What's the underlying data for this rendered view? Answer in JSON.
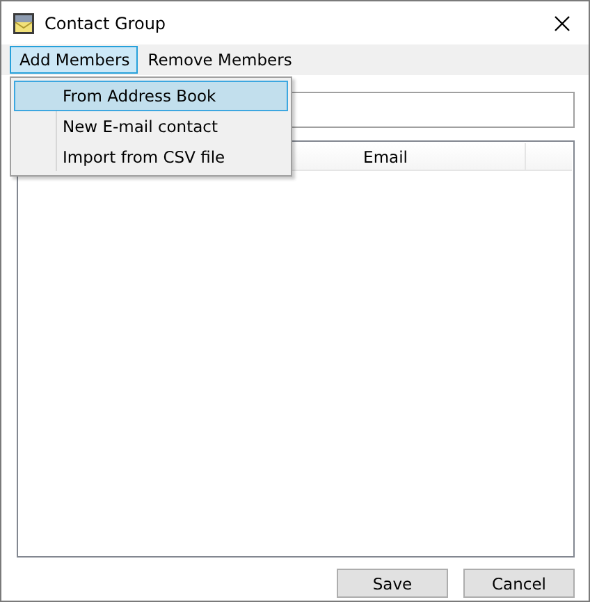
{
  "window": {
    "title": "Contact Group"
  },
  "menu": [
    {
      "label": "Add Members",
      "selected": true
    },
    {
      "label": "Remove Members",
      "selected": false
    }
  ],
  "dropdown": {
    "items": [
      {
        "label": "From Address Book",
        "selected": true
      },
      {
        "label": "New E-mail contact",
        "selected": false
      },
      {
        "label": "Import from CSV file",
        "selected": false
      }
    ]
  },
  "table": {
    "columns": [
      "Email"
    ]
  },
  "buttons": [
    "Save",
    "Cancel"
  ]
}
